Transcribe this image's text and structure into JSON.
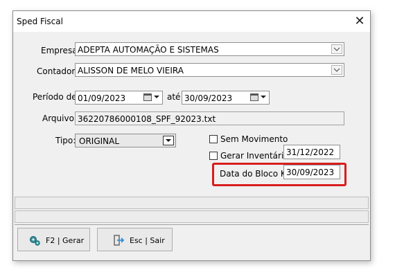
{
  "window": {
    "title": "Sped Fiscal"
  },
  "form": {
    "empresa": {
      "label": "Empresa:",
      "value": "ADEPTA AUTOMAÇÃO E SISTEMAS"
    },
    "contador": {
      "label": "Contador:",
      "value": "ALISSON DE MELO VIEIRA"
    },
    "periodo": {
      "label": "Período de:",
      "start": "01/09/2023",
      "separator": "até",
      "end": "30/09/2023"
    },
    "arquivo": {
      "label": "Arquivo:",
      "value": "36220786000108_SPF_92023.txt"
    },
    "tipo": {
      "label": "Tipo:",
      "value": "ORIGINAL"
    },
    "sem_movimento": {
      "label": "Sem Movimento",
      "checked": false
    },
    "gerar_inventario": {
      "label": "Gerar Inventário",
      "checked": false,
      "date": "31/12/2022"
    },
    "bloco_k": {
      "label": "Data do Bloco K",
      "value": "30/09/2023",
      "highlight_color": "#d81d1d"
    }
  },
  "buttons": {
    "gerar": {
      "label": "F2 | Gerar",
      "icon": "gear-icon"
    },
    "sair": {
      "label": "Esc | Sair",
      "icon": "exit-icon"
    }
  }
}
